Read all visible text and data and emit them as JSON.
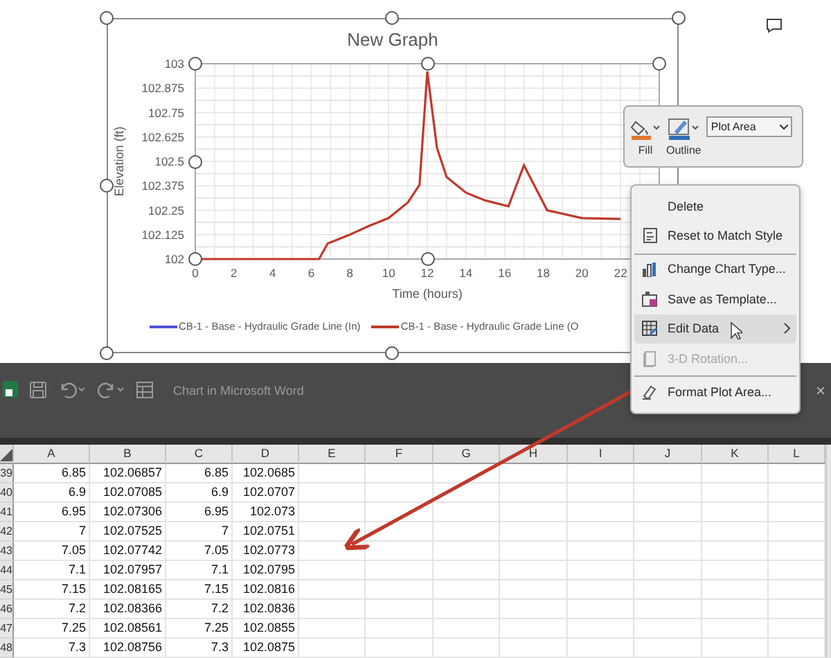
{
  "document": {
    "chart": {
      "title": "New Graph",
      "legend": [
        {
          "label": "CB-1 - Base - Hydraulic Grade Line (In)",
          "color": "#5252d9"
        },
        {
          "label": "CB-1 - Base - Hydraulic Grade Line (O",
          "color": "#c0392b"
        }
      ],
      "chart_data": {
        "type": "line",
        "grid": true,
        "xlabel": "Time (hours)",
        "ylabel": "Elevation (ft)",
        "xlim": [
          0,
          24
        ],
        "ylim": [
          102,
          103
        ],
        "xticks": [
          0,
          2,
          4,
          6,
          8,
          10,
          12,
          14,
          16,
          18,
          20,
          22
        ],
        "yticks": [
          {
            "value": 102,
            "label": "102"
          },
          {
            "value": 102.125,
            "label": "102.125"
          },
          {
            "value": 102.25,
            "label": "102.25"
          },
          {
            "value": 102.375,
            "label": "102.375"
          },
          {
            "value": 102.5,
            "label": "102.5"
          },
          {
            "value": 102.625,
            "label": "102.625"
          },
          {
            "value": 102.75,
            "label": "102.75"
          },
          {
            "value": 102.875,
            "label": "102.875"
          },
          {
            "value": 103,
            "label": "103"
          }
        ],
        "x": [
          0,
          6.4,
          6.85,
          8,
          9,
          10,
          11,
          11.6,
          12,
          12.5,
          13,
          14,
          15,
          16.2,
          17,
          18.2,
          20,
          22
        ],
        "series": [
          {
            "color": "#c0392b",
            "values": [
              102,
              102,
              102.08,
              102.125,
              102.17,
              102.21,
              102.29,
              102.38,
              102.96,
              102.57,
              102.42,
              102.34,
              102.3,
              102.27,
              102.48,
              102.25,
              102.21,
              102.205
            ]
          }
        ]
      }
    }
  },
  "format_toolbar": {
    "buttons": [
      {
        "label": "Fill"
      },
      {
        "label": "Outline"
      }
    ],
    "element_select": {
      "value": "Plot Area"
    }
  },
  "context_menu": {
    "items": [
      {
        "label": "Delete",
        "selected": false,
        "disabled": false,
        "divider_before": false,
        "has_submenu": false
      },
      {
        "label": "Reset to Match Style",
        "selected": false,
        "disabled": false,
        "divider_before": false,
        "has_submenu": false
      },
      {
        "label": "Change Chart Type...",
        "selected": false,
        "disabled": false,
        "divider_before": true,
        "has_submenu": false
      },
      {
        "label": "Save as Template...",
        "selected": false,
        "disabled": false,
        "divider_before": false,
        "has_submenu": false
      },
      {
        "label": "Edit Data",
        "selected": true,
        "disabled": false,
        "divider_before": false,
        "has_submenu": true
      },
      {
        "label": "3-D Rotation...",
        "selected": false,
        "disabled": true,
        "divider_before": false,
        "has_submenu": false
      },
      {
        "label": "Format Plot Area...",
        "selected": false,
        "disabled": false,
        "divider_before": true,
        "has_submenu": false
      }
    ]
  },
  "spreadsheet": {
    "title": "Chart in Microsoft Word",
    "close_glyph": "×",
    "columns": [
      "A",
      "B",
      "C",
      "D",
      "E",
      "F",
      "G",
      "H",
      "I",
      "J",
      "K",
      "L"
    ],
    "rows": [
      {
        "number": "39",
        "cells": [
          "6.85",
          "102.06857",
          "6.85",
          "102.0685"
        ]
      },
      {
        "number": "40",
        "cells": [
          "6.9",
          "102.07085",
          "6.9",
          "102.0707"
        ]
      },
      {
        "number": "41",
        "cells": [
          "6.95",
          "102.07306",
          "6.95",
          "102.073"
        ]
      },
      {
        "number": "42",
        "cells": [
          "7",
          "102.07525",
          "7",
          "102.0751"
        ]
      },
      {
        "number": "43",
        "cells": [
          "7.05",
          "102.07742",
          "7.05",
          "102.0773"
        ]
      },
      {
        "number": "44",
        "cells": [
          "7.1",
          "102.07957",
          "7.1",
          "102.0795"
        ]
      },
      {
        "number": "45",
        "cells": [
          "7.15",
          "102.08165",
          "7.15",
          "102.0816"
        ]
      },
      {
        "number": "46",
        "cells": [
          "7.2",
          "102.08366",
          "7.2",
          "102.0836"
        ]
      },
      {
        "number": "47",
        "cells": [
          "7.25",
          "102.08561",
          "7.25",
          "102.0855"
        ]
      },
      {
        "number": "48",
        "cells": [
          "7.3",
          "102.08756",
          "7.3",
          "102.0875"
        ]
      }
    ]
  }
}
